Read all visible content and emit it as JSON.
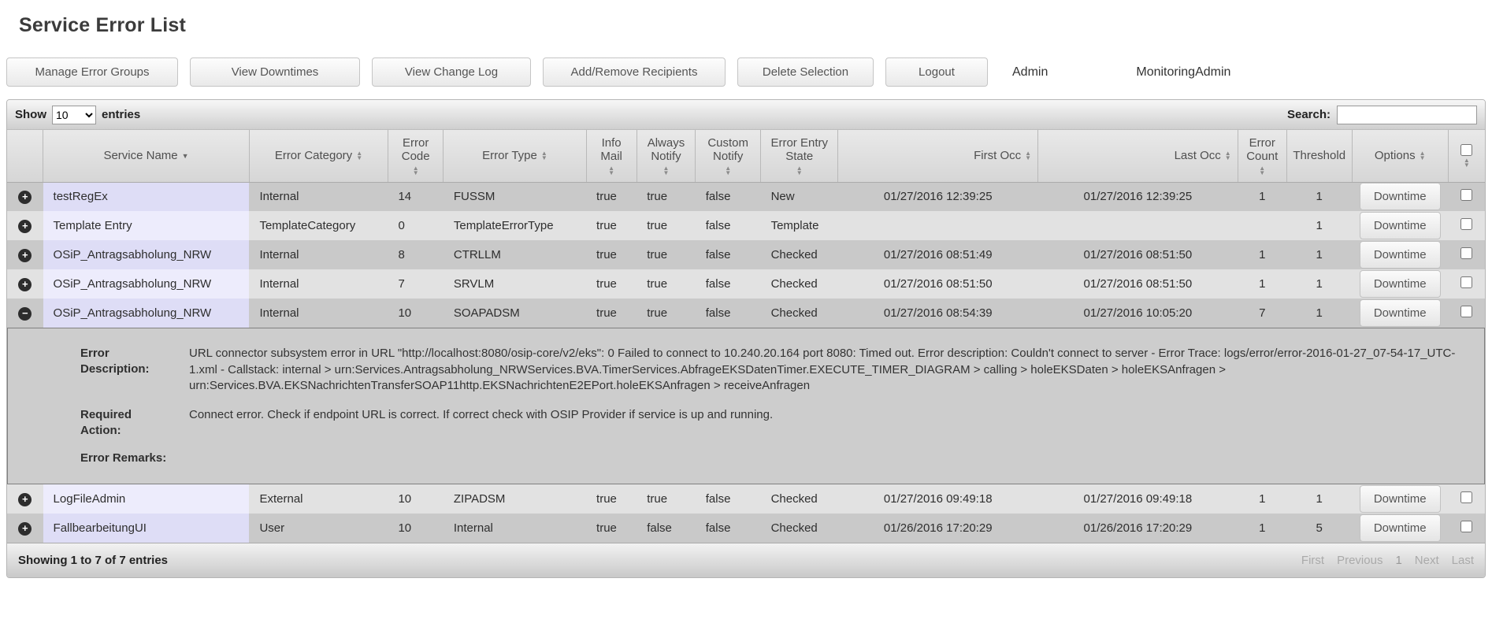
{
  "page": {
    "title": "Service Error List"
  },
  "toolbar": {
    "buttons": [
      {
        "label": "Manage Error Groups"
      },
      {
        "label": "View Downtimes"
      },
      {
        "label": "View Change Log"
      },
      {
        "label": "Add/Remove Recipients"
      },
      {
        "label": "Delete Selection"
      },
      {
        "label": "Logout"
      }
    ],
    "role_label": "Admin",
    "user_label": "MonitoringAdmin"
  },
  "table_controls": {
    "show_label": "Show",
    "page_length": "10",
    "entries_label": "entries",
    "search_label": "Search:",
    "search_value": ""
  },
  "table": {
    "columns": [
      {
        "label": "",
        "sort": "none"
      },
      {
        "label": "Service Name",
        "sort": "desc"
      },
      {
        "label": "Error Category",
        "sort": "both"
      },
      {
        "label": "Error Code",
        "sort": "both"
      },
      {
        "label": "Error Type",
        "sort": "both"
      },
      {
        "label": "Info Mail",
        "sort": "both"
      },
      {
        "label": "Always Notify",
        "sort": "both"
      },
      {
        "label": "Custom Notify",
        "sort": "both"
      },
      {
        "label": "Error Entry State",
        "sort": "both"
      },
      {
        "label": "First Occ",
        "sort": "both"
      },
      {
        "label": "Last Occ",
        "sort": "both"
      },
      {
        "label": "Error Count",
        "sort": "both"
      },
      {
        "label": "Threshold",
        "sort": "none"
      },
      {
        "label": "Options",
        "sort": "both"
      },
      {
        "label": "",
        "sort": "both",
        "header_checkbox": true
      }
    ],
    "rows": [
      {
        "expand": "plus",
        "service_name": "testRegEx",
        "error_category": "Internal",
        "error_code": "14",
        "error_type": "FUSSM",
        "info_mail": "true",
        "always_notify": "true",
        "custom_notify": "false",
        "error_entry_state": "New",
        "first_occ": "01/27/2016 12:39:25",
        "last_occ": "01/27/2016 12:39:25",
        "error_count": "1",
        "threshold": "1",
        "options_label": "Downtime",
        "checked": false
      },
      {
        "expand": "plus",
        "service_name": "Template Entry",
        "error_category": "TemplateCategory",
        "error_code": "0",
        "error_type": "TemplateErrorType",
        "info_mail": "true",
        "always_notify": "true",
        "custom_notify": "false",
        "error_entry_state": "Template",
        "first_occ": "",
        "last_occ": "",
        "error_count": "",
        "threshold": "1",
        "options_label": "Downtime",
        "checked": false
      },
      {
        "expand": "plus",
        "service_name": "OSiP_Antragsabholung_NRW",
        "error_category": "Internal",
        "error_code": "8",
        "error_type": "CTRLLM",
        "info_mail": "true",
        "always_notify": "true",
        "custom_notify": "false",
        "error_entry_state": "Checked",
        "first_occ": "01/27/2016 08:51:49",
        "last_occ": "01/27/2016 08:51:50",
        "error_count": "1",
        "threshold": "1",
        "options_label": "Downtime",
        "checked": false
      },
      {
        "expand": "plus",
        "service_name": "OSiP_Antragsabholung_NRW",
        "error_category": "Internal",
        "error_code": "7",
        "error_type": "SRVLM",
        "info_mail": "true",
        "always_notify": "true",
        "custom_notify": "false",
        "error_entry_state": "Checked",
        "first_occ": "01/27/2016 08:51:50",
        "last_occ": "01/27/2016 08:51:50",
        "error_count": "1",
        "threshold": "1",
        "options_label": "Downtime",
        "checked": false
      },
      {
        "expand": "minus",
        "service_name": "OSiP_Antragsabholung_NRW",
        "error_category": "Internal",
        "error_code": "10",
        "error_type": "SOAPADSM",
        "info_mail": "true",
        "always_notify": "true",
        "custom_notify": "false",
        "error_entry_state": "Checked",
        "first_occ": "01/27/2016 08:54:39",
        "last_occ": "01/27/2016 10:05:20",
        "error_count": "7",
        "threshold": "1",
        "options_label": "Downtime",
        "checked": false
      },
      {
        "expand": "plus",
        "service_name": "LogFileAdmin",
        "error_category": "External",
        "error_code": "10",
        "error_type": "ZIPADSM",
        "info_mail": "true",
        "always_notify": "true",
        "custom_notify": "false",
        "error_entry_state": "Checked",
        "first_occ": "01/27/2016 09:49:18",
        "last_occ": "01/27/2016 09:49:18",
        "error_count": "1",
        "threshold": "1",
        "options_label": "Downtime",
        "checked": false
      },
      {
        "expand": "plus",
        "service_name": "FallbearbeitungUI",
        "error_category": "User",
        "error_code": "10",
        "error_type": "Internal",
        "info_mail": "true",
        "always_notify": "false",
        "custom_notify": "false",
        "error_entry_state": "Checked",
        "first_occ": "01/26/2016 17:20:29",
        "last_occ": "01/26/2016 17:20:29",
        "error_count": "1",
        "threshold": "5",
        "options_label": "Downtime",
        "checked": false
      }
    ],
    "detail": {
      "expanded_row_index": 4,
      "fields": [
        {
          "label": "Error Description:",
          "value": "URL connector subsystem error in URL \"http://localhost:8080/osip-core/v2/eks\": 0 Failed to connect to 10.240.20.164 port 8080: Timed out. Error description: Couldn't connect to server - Error Trace: logs/error/error-2016-01-27_07-54-17_UTC-1.xml - Callstack: internal > urn:Services.Antragsabholung_NRWServices.BVA.TimerServices.AbfrageEKSDatenTimer.EXECUTE_TIMER_DIAGRAM > calling > holeEKSDaten > holeEKSAnfragen > urn:Services.BVA.EKSNachrichtenTransferSOAP11http.EKSNachrichtenE2EPort.holeEKSAnfragen > receiveAnfragen"
        },
        {
          "label": "Required Action:",
          "value": "Connect error. Check if endpoint URL is correct. If correct check with OSIP Provider if service is up and running."
        },
        {
          "label": "Error Remarks:",
          "value": ""
        }
      ]
    }
  },
  "footer": {
    "info": "Showing 1 to 7 of 7 entries",
    "pagination": [
      {
        "label": "First",
        "state": "disabled"
      },
      {
        "label": "Previous",
        "state": "disabled"
      },
      {
        "label": "1",
        "state": "current"
      },
      {
        "label": "Next",
        "state": "disabled"
      },
      {
        "label": "Last",
        "state": "disabled"
      }
    ]
  },
  "colors": {
    "row_odd_bg": "#c9c9c9",
    "row_even_bg": "#e2e2e2",
    "service_cell_odd_bg": "#deddf6",
    "service_cell_even_bg": "#edecfc",
    "detail_panel_bg": "#cdcdcd",
    "button_text": "#555555"
  }
}
